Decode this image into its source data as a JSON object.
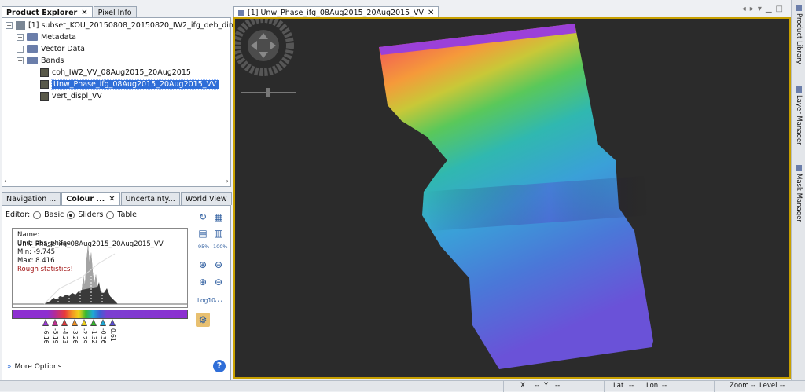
{
  "left_tabs": [
    {
      "label": "Product Explorer",
      "closable": true,
      "active": true
    },
    {
      "label": "Pixel Info",
      "closable": false,
      "active": false
    }
  ],
  "tree": {
    "product": "[1] subset_KOU_20150808_20150820_IW2_ifg_deb_dinsar_flt_ML",
    "folders": [
      "Metadata",
      "Vector Data",
      "Bands"
    ],
    "bands": [
      "coh_IW2_VV_08Aug2015_20Aug2015",
      "Unw_Phase_ifg_08Aug2015_20Aug2015_VV",
      "vert_displ_VV"
    ],
    "selected_band_index": 1
  },
  "mid_tabs": [
    {
      "label": "Navigation ...",
      "closable": false
    },
    {
      "label": "Colour ...",
      "closable": true,
      "active": true
    },
    {
      "label": "Uncertainty...",
      "closable": false
    },
    {
      "label": "World View",
      "closable": false
    }
  ],
  "editor": {
    "label": "Editor:",
    "options": [
      "Basic",
      "Sliders",
      "Table"
    ],
    "selected": "Sliders"
  },
  "histogram": {
    "name": "Name: Unw_Phase_ifg_08Aug2015_20Aug2015_VV",
    "unit": "Unit: abs_phase",
    "min": "Min: -9.745",
    "max": "Max: 8.416",
    "rough": "Rough statistics!"
  },
  "slider_ticks": [
    "-6.16",
    "-5.19",
    "-4.23",
    "-3.26",
    "-2.29",
    "-1.32",
    "-0.36",
    "0.61"
  ],
  "slider_colors": [
    "#9b3ad6",
    "#c03090",
    "#e03c3c",
    "#f39323",
    "#f0d21a",
    "#35b82d",
    "#1fa9d6",
    "#5a4ed6"
  ],
  "tools": {
    "zoom95": "95%",
    "zoom100": "100%",
    "log_label": "Log10"
  },
  "more_options": "More Options",
  "view_tab": {
    "label": "[1] Unw_Phase_ifg_08Aug2015_20Aug2015_VV",
    "closable": true
  },
  "right_tabs": [
    "Product Library",
    "Layer Manager",
    "Mask Manager"
  ],
  "status": {
    "x": "X",
    "x_val": "--",
    "y": "Y",
    "y_val": "--",
    "lat": "Lat",
    "lat_val": "--",
    "lon": "Lon",
    "lon_val": "--",
    "zoom": "Zoom",
    "zoom_val": "--",
    "level": "Level",
    "level_val": "--"
  }
}
